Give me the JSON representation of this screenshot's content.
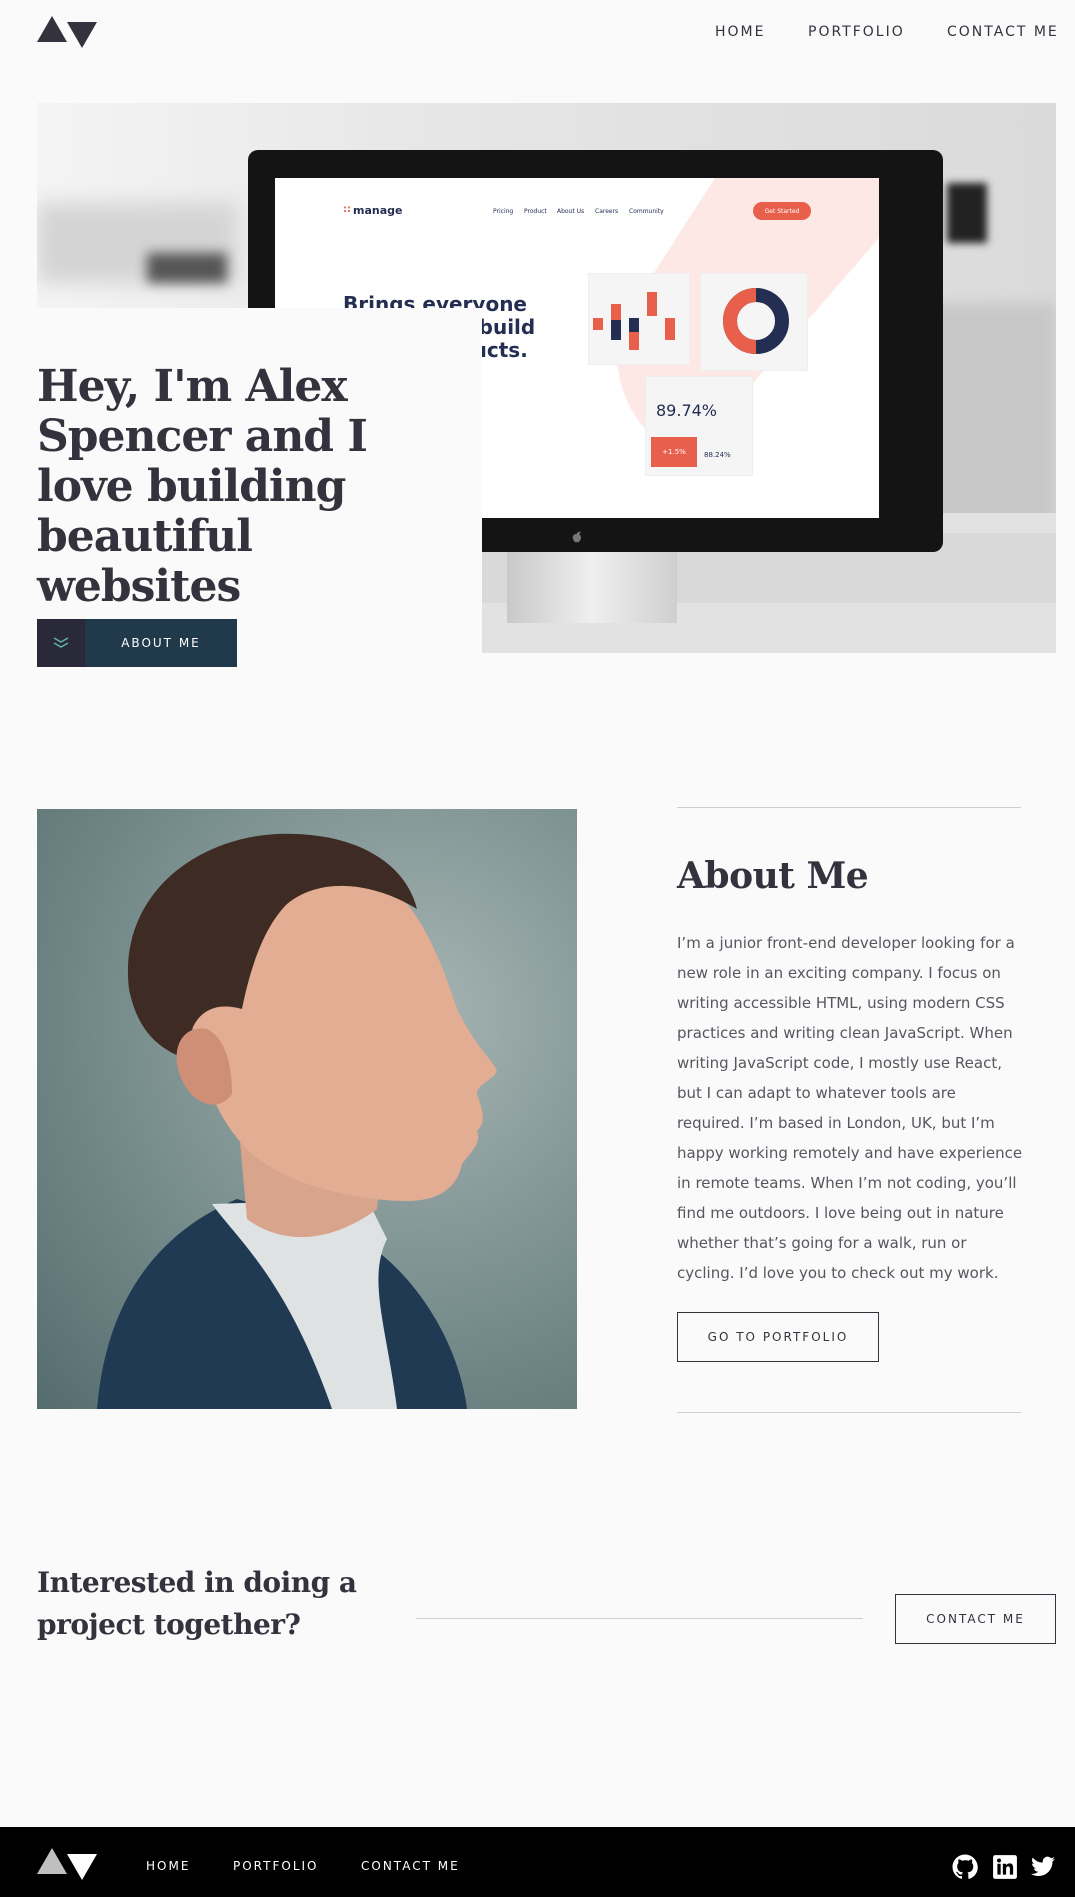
{
  "header": {
    "logo_alt": "logo",
    "nav": [
      "HOME",
      "PORTFOLIO",
      "CONTACT ME"
    ]
  },
  "hero": {
    "title": "Hey, I'm Alex Spencer and I love building beautiful websites",
    "button_label": "ABOUT ME",
    "mockup": {
      "brand": "manage",
      "nav": [
        "Pricing",
        "Product",
        "About Us",
        "Careers",
        "Community"
      ],
      "cta": "Get Started",
      "headline": [
        "Brings everyone",
        "together to build",
        "better products."
      ],
      "stat_main": "89.74%",
      "stat_badge": "+1.5%",
      "stat_secondary": "88.24%"
    }
  },
  "about": {
    "heading": "About Me",
    "body": "I’m a junior front-end developer looking for a new role in an exciting company. I focus on writing accessible HTML, using modern CSS practices and writing clean JavaScript. When writing JavaScript code, I mostly use React, but I can adapt to whatever tools are required. I’m based in London, UK, but I’m happy working remotely and have experience in remote teams. When I’m not coding, you’ll find me outdoors. I love being out in nature whether that’s going for a walk, run or cycling. I’d love you to check out my work.",
    "button_label": "GO TO PORTFOLIO"
  },
  "cta": {
    "title": "Interested in doing a project together?",
    "button_label": "CONTACT ME"
  },
  "footer": {
    "nav": [
      "HOME",
      "PORTFOLIO",
      "CONTACT ME"
    ],
    "social_icons": [
      "github-icon",
      "linkedin-icon",
      "twitter-icon"
    ]
  },
  "colors": {
    "text": "#33323d",
    "background": "#fafafa",
    "button_dark": "#203a4c",
    "accent_red": "#e8604c",
    "footer": "#000000"
  }
}
